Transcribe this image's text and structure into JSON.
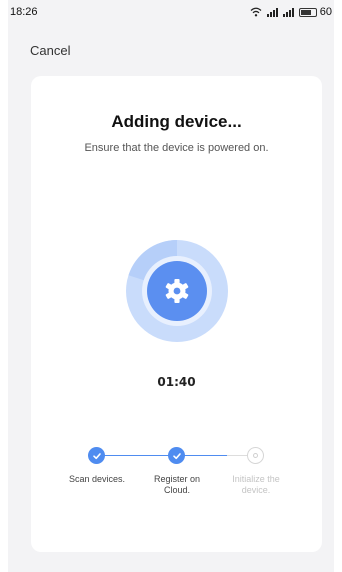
{
  "status_bar": {
    "time": "18:26",
    "battery": "60"
  },
  "header": {
    "cancel_label": "Cancel"
  },
  "dialog": {
    "title": "Adding device...",
    "subtitle": "Ensure that the device is powered on.",
    "timer": "01:40",
    "progress_fraction": 0.8,
    "accent_color": "#4f8cf0"
  },
  "steps": [
    {
      "label": "Scan devices.",
      "state": "done"
    },
    {
      "label": "Register on Cloud.",
      "state": "done"
    },
    {
      "label": "Initialize the device.",
      "state": "pending"
    }
  ],
  "icons": {
    "center_icon": "gear-icon",
    "done_icon": "check-icon"
  }
}
